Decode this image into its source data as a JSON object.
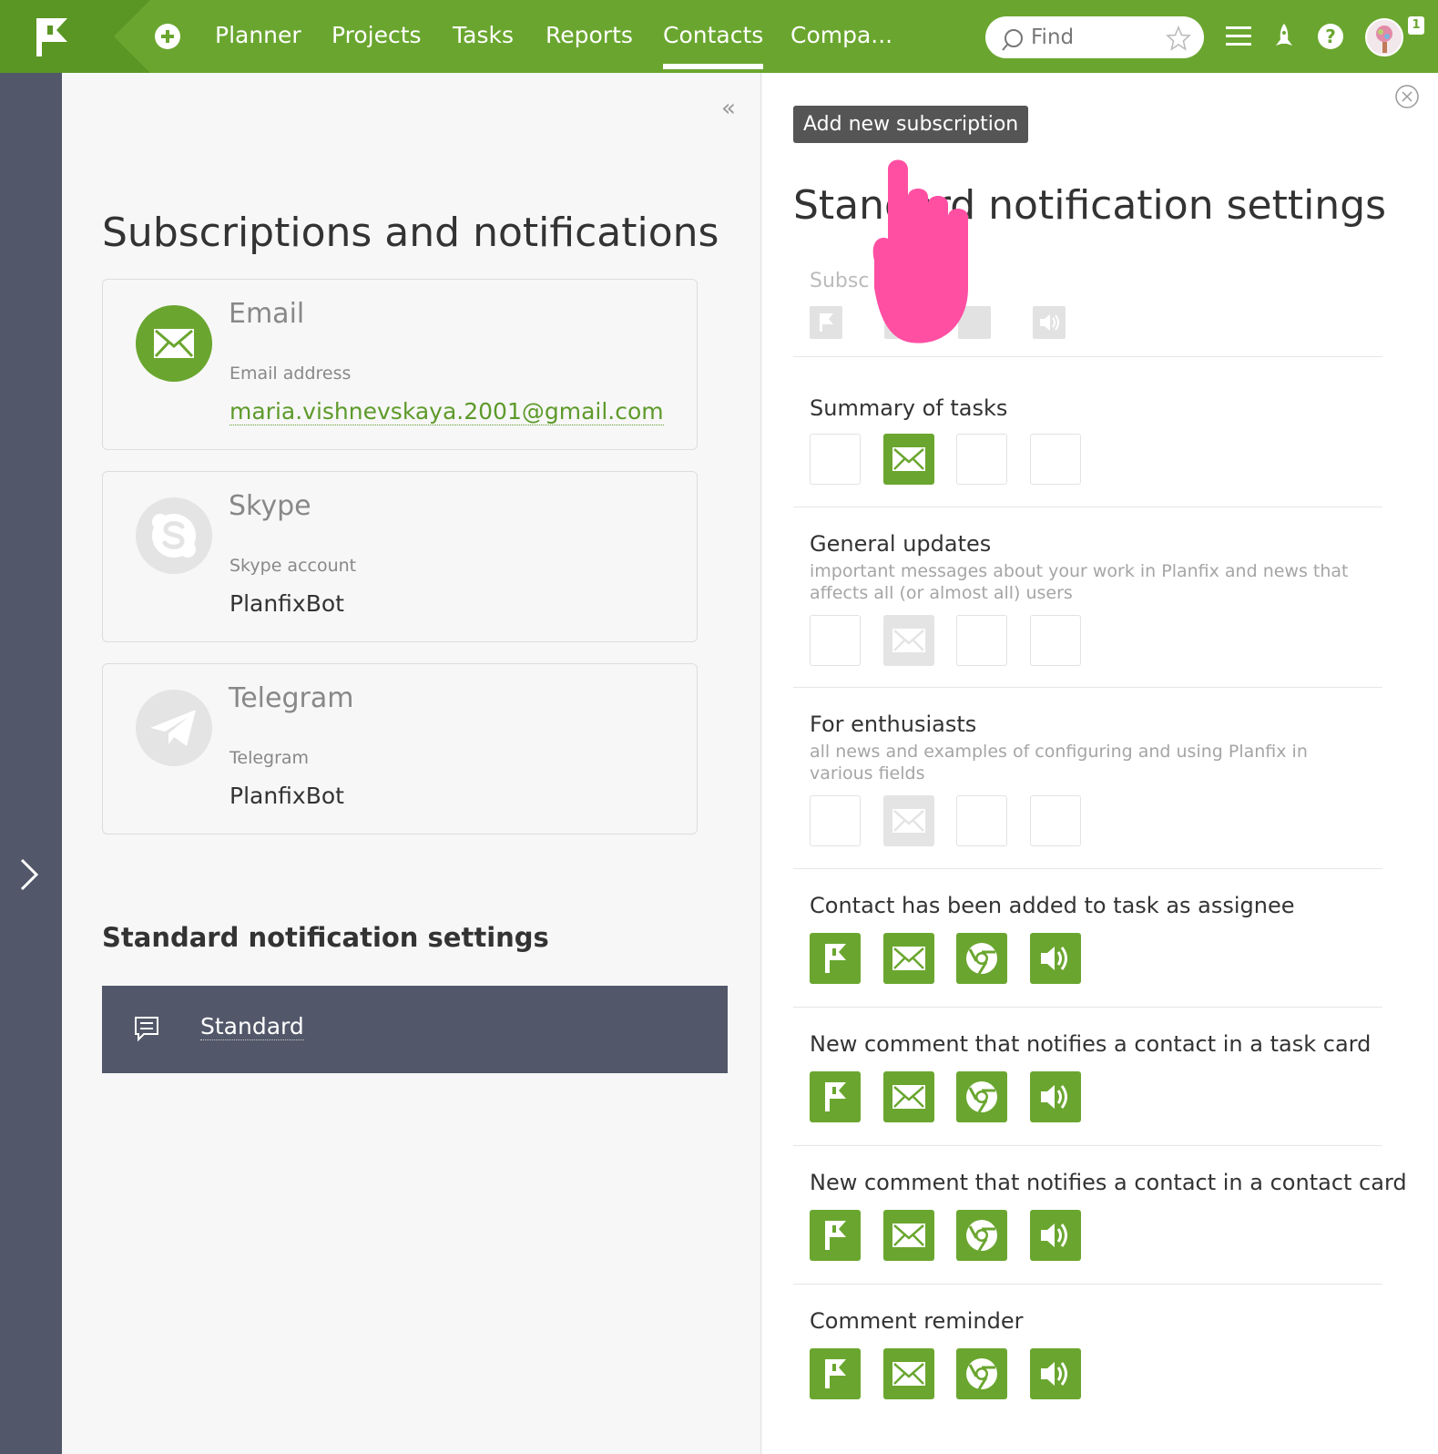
{
  "topbar": {
    "nav": [
      {
        "label": "Planner",
        "active": false
      },
      {
        "label": "Projects",
        "active": false
      },
      {
        "label": "Tasks",
        "active": false
      },
      {
        "label": "Reports",
        "active": false
      },
      {
        "label": "Contacts",
        "active": true
      },
      {
        "label": "Compa...",
        "active": false
      }
    ],
    "search_placeholder": "Find",
    "help_symbol": "?",
    "notification_count": "1",
    "accent_color": "#6aa62f"
  },
  "left": {
    "title": "Subscriptions and notifications",
    "collapse_symbol": "«",
    "channels": [
      {
        "name": "Email",
        "label": "Email address",
        "value": "maria.vishnevskaya.2001@gmail.com",
        "icon": "envelope-icon"
      },
      {
        "name": "Skype",
        "label": "Skype account",
        "value": "PlanfixBot",
        "icon": "skype-icon"
      },
      {
        "name": "Telegram",
        "label": "Telegram",
        "value": "PlanfixBot",
        "icon": "telegram-icon"
      }
    ],
    "standard_heading": "Standard notification settings",
    "standard_item": "Standard"
  },
  "right": {
    "tooltip": "Add new subscription",
    "title": "Standard notification settings",
    "subscriptions_label": "Subsc",
    "sections": [
      {
        "title": "Summary of tasks",
        "desc": "",
        "states": [
          "empty",
          "on",
          "empty",
          "empty"
        ]
      },
      {
        "title": "General updates",
        "desc": "important messages about your work in Planfix and news that affects all (or almost all) users",
        "states": [
          "empty",
          "off",
          "empty",
          "empty"
        ]
      },
      {
        "title": "For enthusiasts",
        "desc": "all news and examples of configuring and using Planfix in various fields",
        "states": [
          "empty",
          "off",
          "empty",
          "empty"
        ]
      },
      {
        "title": "Contact has been added to task as assignee",
        "desc": "",
        "states": [
          "on",
          "on",
          "on",
          "on"
        ]
      },
      {
        "title": "New comment that notifies a contact in a task card",
        "desc": "",
        "states": [
          "on",
          "on",
          "on",
          "on"
        ]
      },
      {
        "title": "New comment that notifies a contact in a contact card",
        "desc": "",
        "states": [
          "on",
          "on",
          "on",
          "on"
        ]
      },
      {
        "title": "Comment reminder",
        "desc": "",
        "states": [
          "on",
          "on",
          "on",
          "on"
        ]
      }
    ],
    "channel_icons": [
      "planfix-flag-icon",
      "email-icon",
      "chrome-icon",
      "sound-icon"
    ]
  }
}
